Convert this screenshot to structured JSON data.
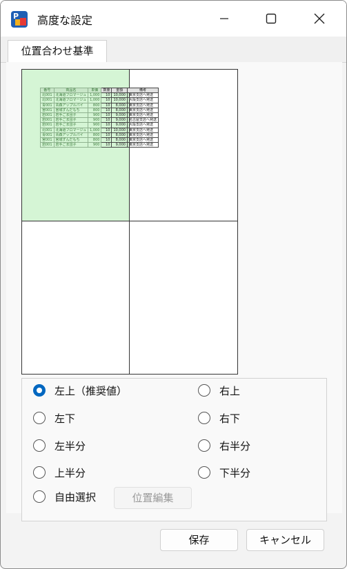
{
  "window": {
    "title": "高度な設定"
  },
  "tabs": [
    {
      "label": "位置合わせ基準"
    }
  ],
  "preview": {
    "table": {
      "headers": [
        "番号",
        "商品名",
        "単価",
        "数量",
        "金額",
        "備考"
      ],
      "rows": [
        [
          "北001",
          "北海道フロマージュ",
          "1,000",
          "10",
          "10,000",
          "東京支店へ発送"
        ],
        [
          "北001",
          "北海道フロマージュ",
          "1,000",
          "10",
          "10,000",
          "大阪支店へ発送"
        ],
        [
          "青001",
          "青森アップルパイ",
          "800",
          "10",
          "8,000",
          "東京支店へ発送"
        ],
        [
          "宮001",
          "宮城ずんだもち",
          "800",
          "10",
          "8,000",
          "東京支店へ発送"
        ],
        [
          "岩001",
          "岩手ごま団子",
          "900",
          "10",
          "9,000",
          "東京支店へ発送"
        ],
        [
          "岩001",
          "岩手ごま団子",
          "900",
          "10",
          "9,000",
          "名古屋支店へ発送"
        ],
        [
          "岩001",
          "岩手ごま団子",
          "900",
          "10",
          "9,000",
          "大阪支店へ発送"
        ],
        [
          "北001",
          "北海道フロマージュ",
          "1,000",
          "10",
          "10,000",
          "東京支店へ発送"
        ],
        [
          "青001",
          "青森アップルパイ",
          "800",
          "10",
          "8,000",
          "東京支店へ発送"
        ],
        [
          "宮001",
          "宮城ずんだもち",
          "800",
          "10",
          "8,000",
          "東京支店へ発送"
        ],
        [
          "岩001",
          "岩手ごま団子",
          "900",
          "10",
          "9,000",
          "東京支店へ発送"
        ]
      ]
    }
  },
  "options": {
    "top_left": "左上（推奨値）",
    "top_right": "右上",
    "bottom_left": "左下",
    "bottom_right": "右下",
    "left_half": "左半分",
    "right_half": "右半分",
    "top_half": "上半分",
    "bottom_half": "下半分",
    "free": "自由選択",
    "selected": "top_left"
  },
  "buttons": {
    "edit_position": "位置編集",
    "save": "保存",
    "cancel": "キャンセル"
  },
  "colors": {
    "accent": "#0067c0",
    "highlight": "#d5f5d5"
  }
}
